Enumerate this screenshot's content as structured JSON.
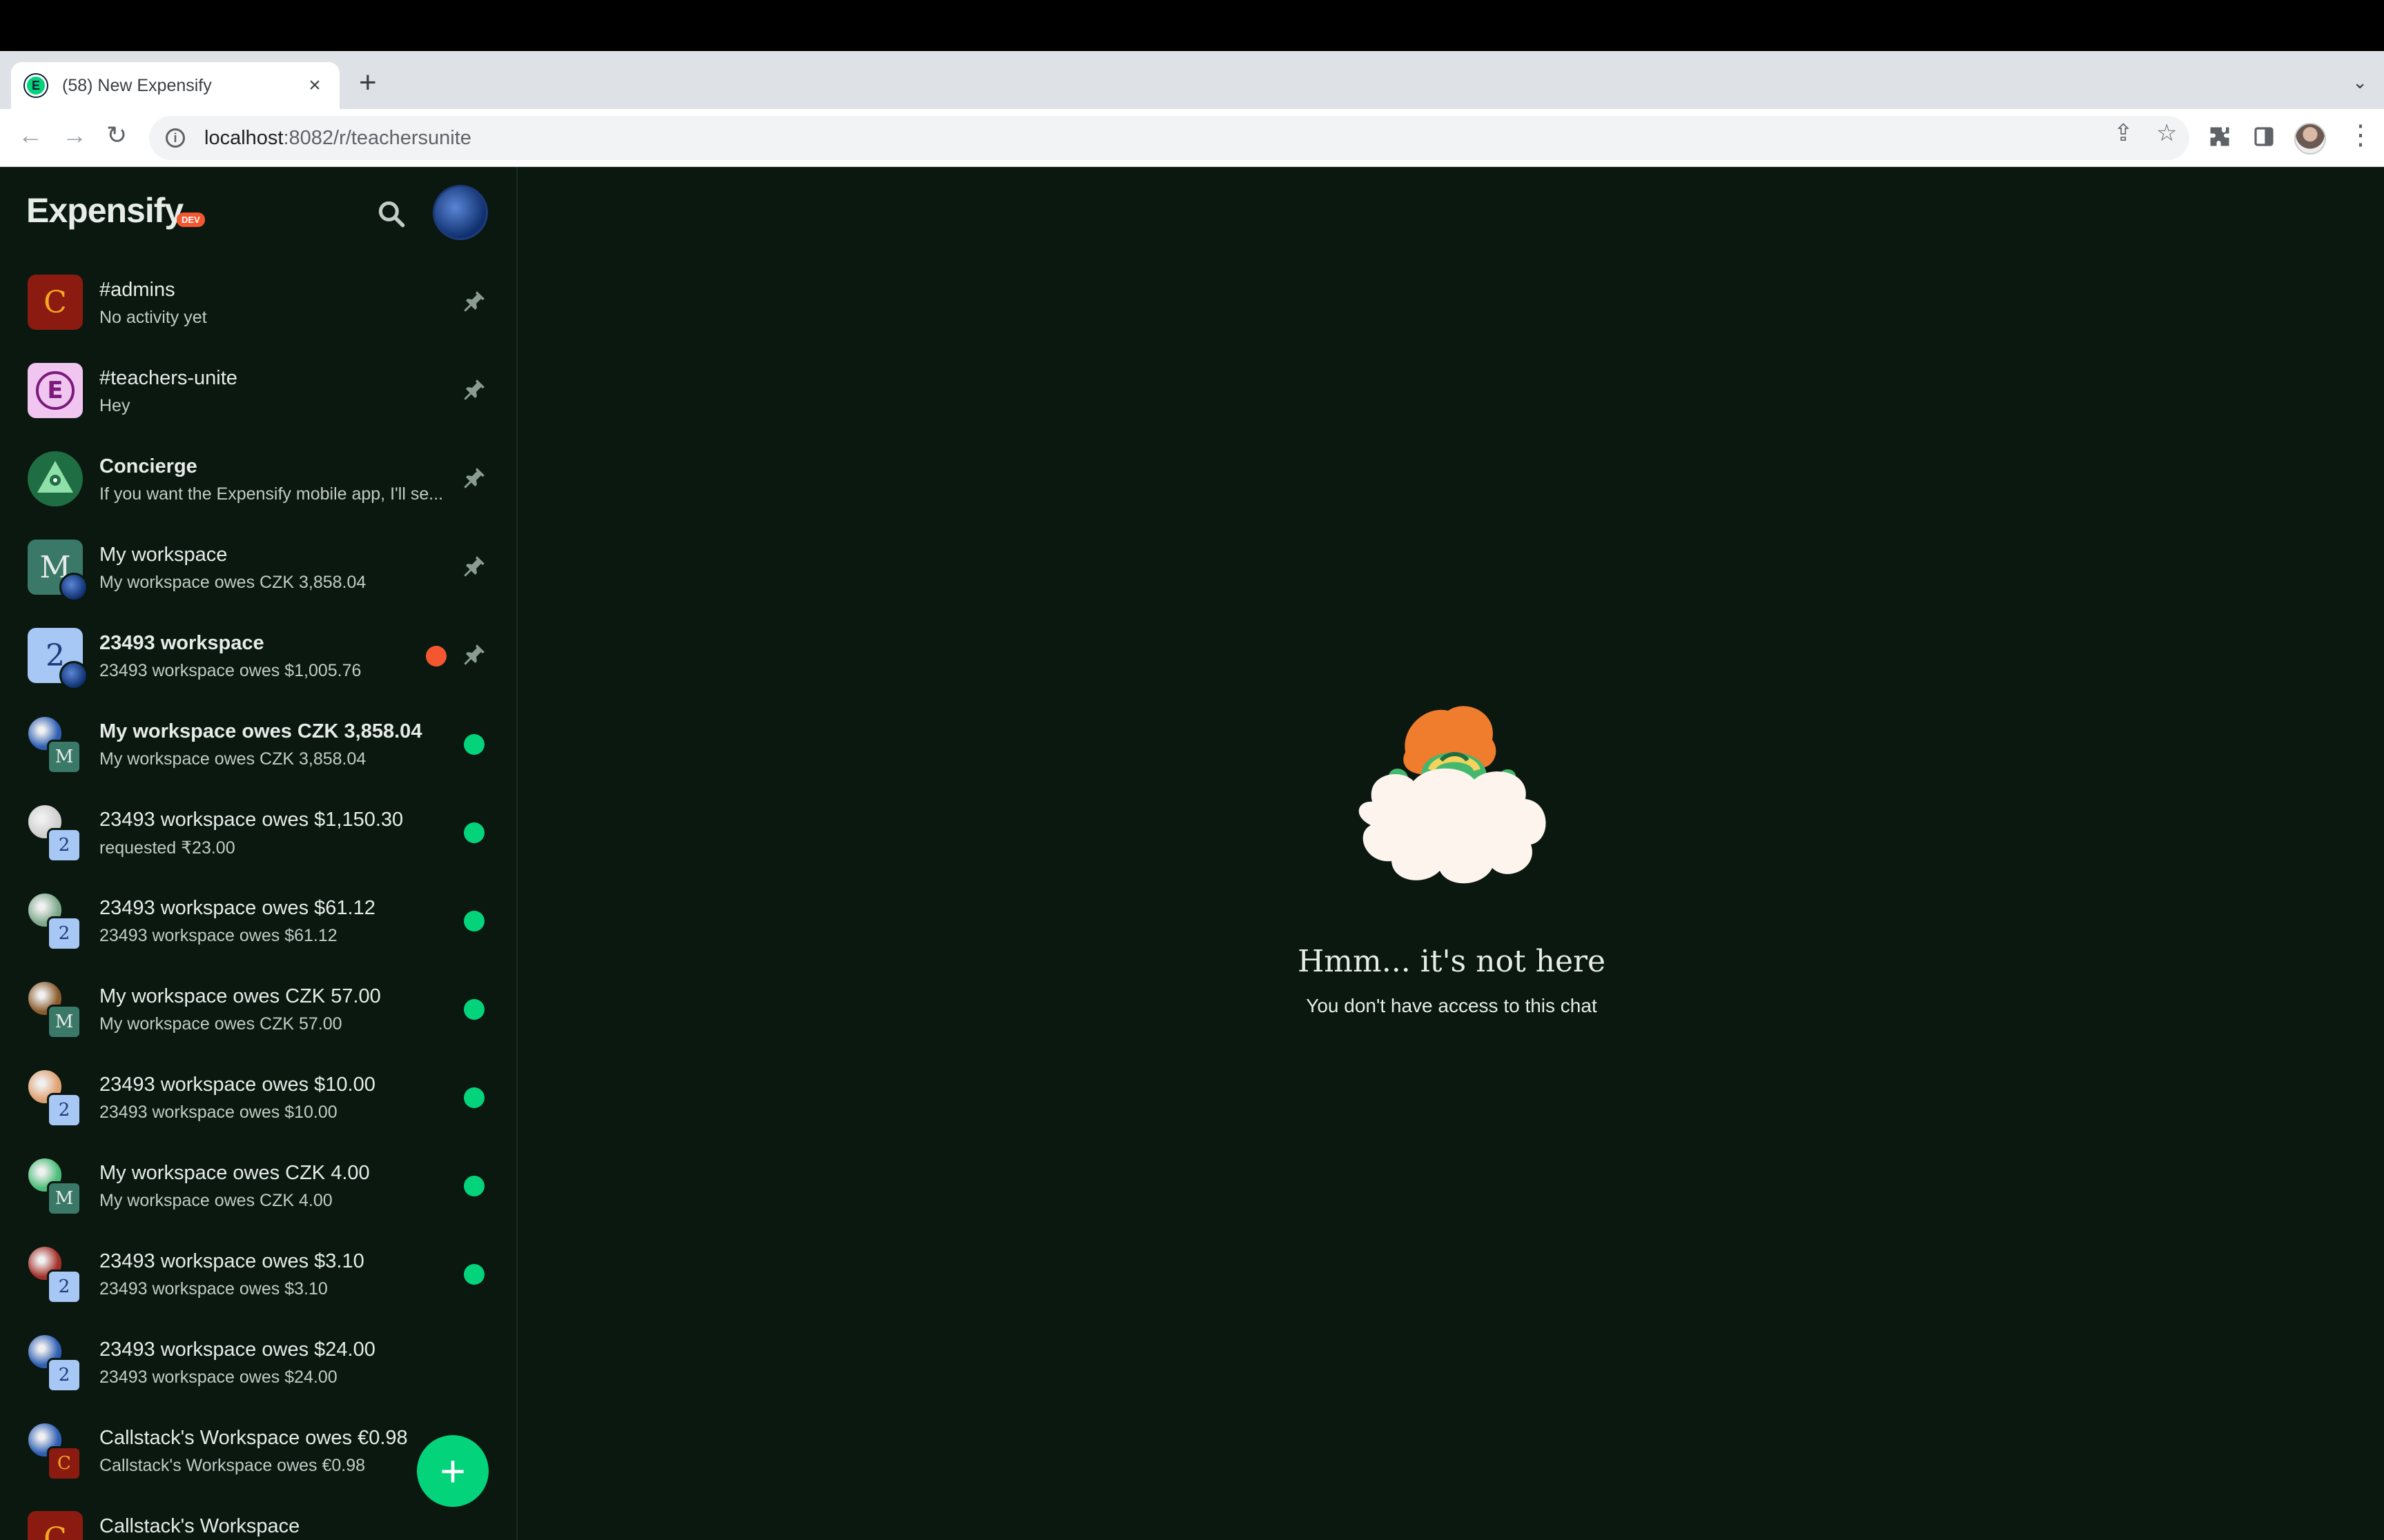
{
  "browser": {
    "tab_title": "(58) New Expensify",
    "tab_close": "×",
    "new_tab": "+",
    "tab_menu": "⌄",
    "url_host": "localhost",
    "url_path": ":8082/r/teachersunite",
    "favicon_letter": "E"
  },
  "app": {
    "brand": "Expensify",
    "dev_badge": "DEV",
    "fab_label": "+"
  },
  "chats": [
    {
      "title": "#admins",
      "subtitle": "No activity yet",
      "avatar": "C",
      "avatar_bg": "#8b1a10",
      "avatar_fg": "#f5a623",
      "bold": false,
      "indicator": "pin"
    },
    {
      "title": "#teachers-unite",
      "subtitle": "Hey",
      "avatar": "E",
      "avatar_bg": "#f0c6f0",
      "avatar_fg": "#7b1a7b",
      "bold": false,
      "indicator": "pin"
    },
    {
      "title": "Concierge",
      "subtitle": "If you want the Expensify mobile app, I'll se...",
      "avatar": "",
      "avatar_bg": "#1f6e43",
      "avatar_fg": "#fff",
      "bold": true,
      "indicator": "pin"
    },
    {
      "title": "My workspace",
      "subtitle": "My workspace owes CZK 3,858.04",
      "avatar": "M",
      "avatar_bg": "#3a7867",
      "avatar_fg": "#e7ece9",
      "bold": false,
      "indicator": "pin"
    },
    {
      "title": "23493 workspace",
      "subtitle": "23493 workspace owes $1,005.76",
      "avatar": "2",
      "avatar_bg": "#a7c7f5",
      "avatar_fg": "#1a3a7a",
      "bold": true,
      "indicator": "red-pin"
    },
    {
      "title": "My workspace owes CZK 3,858.04",
      "subtitle": "My workspace owes CZK 3,858.04",
      "avatar": "M",
      "avatar_bg": "#3a7867",
      "avatar_fg": "#e7ece9",
      "bold": true,
      "indicator": "green"
    },
    {
      "title": "23493 workspace owes $1,150.30",
      "subtitle": "requested ₹23.00",
      "avatar": "2",
      "avatar_bg": "#a7c7f5",
      "avatar_fg": "#1a3a7a",
      "bold": false,
      "indicator": "green"
    },
    {
      "title": "23493 workspace owes $61.12",
      "subtitle": "23493 workspace owes $61.12",
      "avatar": "2",
      "avatar_bg": "#a7c7f5",
      "avatar_fg": "#1a3a7a",
      "bold": false,
      "indicator": "green"
    },
    {
      "title": "My workspace owes CZK 57.00",
      "subtitle": "My workspace owes CZK 57.00",
      "avatar": "M",
      "avatar_bg": "#3a7867",
      "avatar_fg": "#e7ece9",
      "bold": false,
      "indicator": "green"
    },
    {
      "title": "23493 workspace owes $10.00",
      "subtitle": "23493 workspace owes $10.00",
      "avatar": "2",
      "avatar_bg": "#a7c7f5",
      "avatar_fg": "#1a3a7a",
      "bold": false,
      "indicator": "green"
    },
    {
      "title": "My workspace owes CZK 4.00",
      "subtitle": "My workspace owes CZK 4.00",
      "avatar": "M",
      "avatar_bg": "#3a7867",
      "avatar_fg": "#e7ece9",
      "bold": false,
      "indicator": "green"
    },
    {
      "title": "23493 workspace owes $3.10",
      "subtitle": "23493 workspace owes $3.10",
      "avatar": "2",
      "avatar_bg": "#a7c7f5",
      "avatar_fg": "#1a3a7a",
      "bold": false,
      "indicator": "green"
    },
    {
      "title": "23493 workspace owes $24.00",
      "subtitle": "23493 workspace owes $24.00",
      "avatar": "2",
      "avatar_bg": "#a7c7f5",
      "avatar_fg": "#1a3a7a",
      "bold": false,
      "indicator": "none"
    },
    {
      "title": "Callstack's Workspace owes €0.98",
      "subtitle": "Callstack's Workspace owes €0.98",
      "avatar": "C",
      "avatar_bg": "#8b1a10",
      "avatar_fg": "#f5a623",
      "bold": false,
      "indicator": "none"
    },
    {
      "title": "Callstack's Workspace",
      "subtitle": "",
      "avatar": "C",
      "avatar_bg": "#8b1a10",
      "avatar_fg": "#f5a623",
      "bold": false,
      "indicator": "none"
    }
  ],
  "empty_state": {
    "title": "Hmm... it's not here",
    "subtitle": "You don't have access to this chat"
  },
  "colors": {
    "accent_green": "#03d47c",
    "alert_red": "#f25730",
    "app_bg": "#0a180f"
  }
}
